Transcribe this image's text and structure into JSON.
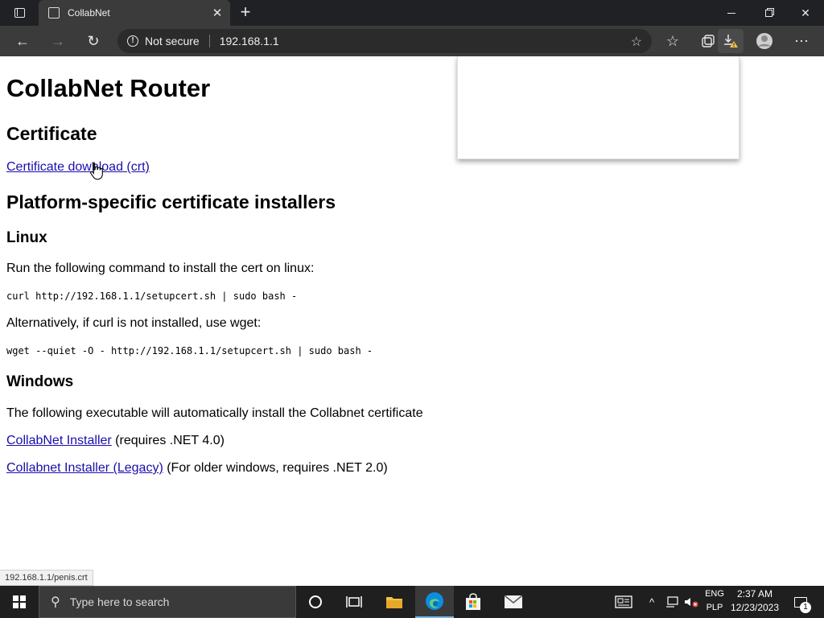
{
  "browser": {
    "tab_title": "CollabNet",
    "security_label": "Not secure",
    "url": "192.168.1.1",
    "status_url": "192.168.1.1/penis.crt"
  },
  "page": {
    "title": "CollabNet Router",
    "certificate_heading": "Certificate",
    "certificate_link": "Certificate download (crt)",
    "installers_heading": "Platform-specific certificate installers",
    "linux_heading": "Linux",
    "linux_text": "Run the following command to install the cert on linux:",
    "linux_cmd_curl": "curl http://192.168.1.1/setupcert.sh | sudo bash -",
    "linux_alt_text": "Alternatively, if curl is not installed, use wget:",
    "linux_cmd_wget": "wget --quiet -O - http://192.168.1.1/setupcert.sh | sudo bash -",
    "windows_heading": "Windows",
    "windows_text": "The following executable will automatically install the Collabnet certificate",
    "installer_link": "CollabNet Installer",
    "installer_note": " (requires .NET 4.0)",
    "legacy_link": "Collabnet Installer (Legacy)",
    "legacy_note": " (For older windows, requires .NET 2.0)"
  },
  "taskbar": {
    "search_placeholder": "Type here to search",
    "lang_top": "ENG",
    "lang_bottom": "PLP",
    "time": "2:37 AM",
    "date": "12/23/2023",
    "notification_count": "1"
  },
  "colors": {
    "link": "#1a0dab",
    "titlebar": "#202124",
    "toolbar": "#3b3b3b",
    "taskbar": "#1f1f1f",
    "edge_blue": "#0c8ee0",
    "explorer_yellow": "#f3c23f"
  }
}
